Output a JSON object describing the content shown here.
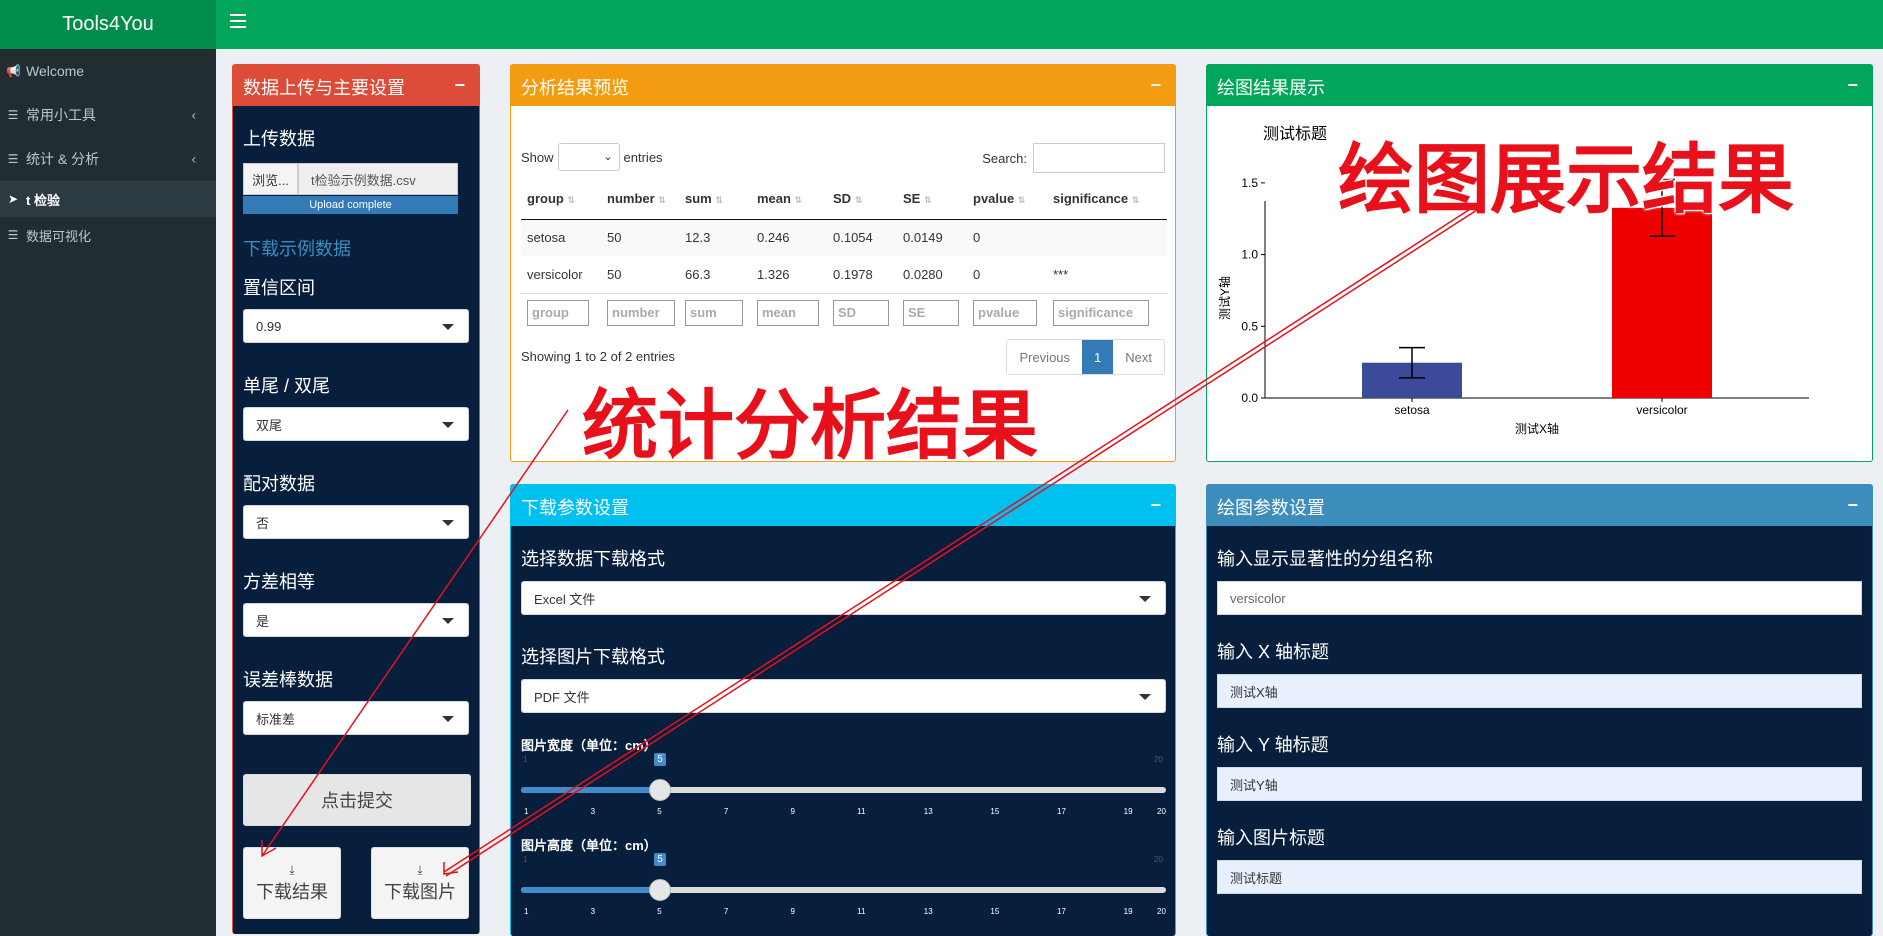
{
  "app": {
    "brand": "Tools4You"
  },
  "sidebar": {
    "items": [
      {
        "label": "Welcome"
      },
      {
        "label": "常用小工具"
      },
      {
        "label": "统计 & 分析"
      },
      {
        "label": "t 检验"
      },
      {
        "label": "数据可视化"
      }
    ]
  },
  "upload_panel": {
    "title": "数据上传与主要设置",
    "upload_label": "上传数据",
    "browse_button": "浏览...",
    "file_name": "t检验示例数据.csv",
    "progress_text": "Upload complete",
    "progress": 1.0,
    "download_example": "下载示例数据",
    "ci_label": "置信区间",
    "ci_value": "0.99",
    "tail_label": "单尾 / 双尾",
    "tail_value": "双尾",
    "paired_label": "配对数据",
    "paired_value": "否",
    "var_label": "方差相等",
    "var_value": "是",
    "err_label": "误差棒数据",
    "err_value": "标准差",
    "submit_button": "点击提交",
    "download_result_button": "下载结果",
    "download_plot_button": "下载图片"
  },
  "results_panel": {
    "title": "分析结果预览",
    "show_label": "Show",
    "entries_label": "entries",
    "search_label": "Search:",
    "columns": [
      "group",
      "number",
      "sum",
      "mean",
      "SD",
      "SE",
      "pvalue",
      "significance"
    ],
    "rows": [
      [
        "setosa",
        "50",
        "12.3",
        "0.246",
        "0.1054",
        "0.0149",
        "0",
        ""
      ],
      [
        "versicolor",
        "50",
        "66.3",
        "1.326",
        "0.1978",
        "0.0280",
        "0",
        "***"
      ]
    ],
    "filters": [
      "group",
      "number",
      "sum",
      "mean",
      "SD",
      "SE",
      "pvalue",
      "significance"
    ],
    "info": "Showing 1 to 2 of 2 entries",
    "prev": "Previous",
    "page": "1",
    "next": "Next"
  },
  "plot_panel": {
    "title": "绘图结果展示"
  },
  "chart_data": {
    "type": "bar",
    "title": "测试标题",
    "xlabel": "测试X轴",
    "ylabel": "测试Y轴",
    "categories": [
      "setosa",
      "versicolor"
    ],
    "values": [
      0.246,
      1.326
    ],
    "errors": [
      0.1054,
      0.1978
    ],
    "bar_colors": [
      "#3b4b9a",
      "#ee0000"
    ],
    "significance": [
      "",
      "***"
    ],
    "ylim": [
      0,
      1.75
    ],
    "yticks": [
      "0.0",
      "0.5",
      "1.0",
      "1.5"
    ]
  },
  "download_panel": {
    "title": "下载参数设置",
    "data_format_label": "选择数据下载格式",
    "data_format_value": "Excel 文件",
    "image_format_label": "选择图片下载格式",
    "image_format_value": "PDF 文件",
    "width_label": "图片宽度（单位：cm）",
    "width_value": "5",
    "height_label": "图片高度（单位：cm）",
    "height_value": "5",
    "slider_min_label": "1",
    "slider_max_label": "20",
    "slider_ticks": [
      "1",
      "3",
      "5",
      "7",
      "9",
      "11",
      "13",
      "15",
      "17",
      "19",
      "20"
    ]
  },
  "plot_params_panel": {
    "title": "绘图参数设置",
    "sig_group_label": "输入显示显著性的分组名称",
    "sig_group_value": "versicolor",
    "x_title_label": "输入 X 轴标题",
    "x_title_value": "测试X轴",
    "y_title_label": "输入 Y 轴标题",
    "y_title_value": "测试Y轴",
    "plot_title_label": "输入图片标题",
    "plot_title_value": "测试标题"
  },
  "annotations": {
    "plot_result": "绘图展示结果",
    "stat_result": "统计分析结果"
  }
}
